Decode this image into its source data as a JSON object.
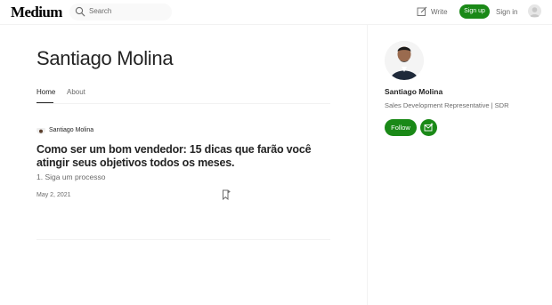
{
  "header": {
    "logo": "Medium",
    "search_placeholder": "Search",
    "write_label": "Write",
    "signup_label": "Sign up",
    "signin_label": "Sign in"
  },
  "profile": {
    "name": "Santiago Molina",
    "tabs": [
      {
        "label": "Home",
        "active": true
      },
      {
        "label": "About",
        "active": false
      }
    ]
  },
  "post": {
    "author": "Santiago Molina",
    "title": "Como ser um bom vendedor: 15 dicas que farão você atingir seus objetivos todos os meses.",
    "subtitle": "1. Siga um processo",
    "date": "May 2, 2021"
  },
  "sidebar": {
    "name": "Santiago Molina",
    "bio": "Sales Development Representative | SDR",
    "follow_label": "Follow"
  },
  "colors": {
    "accent": "#1a8917",
    "text": "#242424",
    "muted": "#6b6b6b"
  }
}
